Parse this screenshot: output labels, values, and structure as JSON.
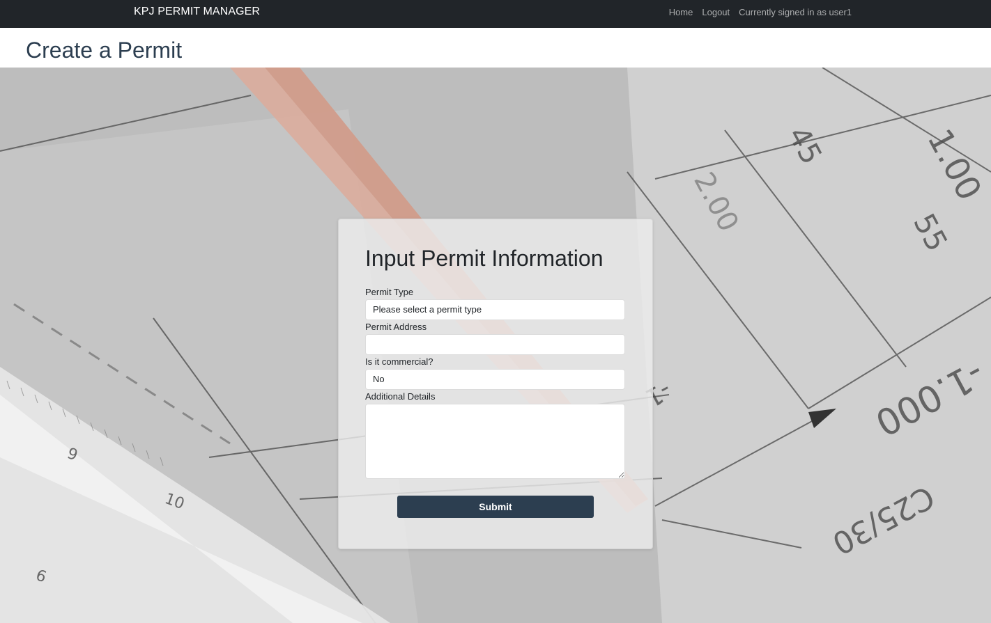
{
  "navbar": {
    "brand": "KPJ PERMIT MANAGER",
    "links": [
      "Home",
      "Logout"
    ],
    "signed_in_text": "Currently signed in as user1"
  },
  "header": {
    "title": "Create a Permit"
  },
  "form": {
    "title": "Input Permit Information",
    "permit_type_label": "Permit Type",
    "permit_type_value": "Please select a permit type",
    "address_label": "Permit Address",
    "address_value": "",
    "commercial_label": "Is it commercial?",
    "commercial_value": "No",
    "details_label": "Additional Details",
    "details_value": "",
    "submit_label": "Submit"
  },
  "colors": {
    "navbar_bg": "#212529",
    "accent": "#2c3e50"
  },
  "background_image": {
    "printed_text": [
      "1.00",
      "45",
      "55",
      "2.00",
      "-1.000",
      "C25/30",
      "9",
      "10",
      "6",
      "-1"
    ]
  }
}
